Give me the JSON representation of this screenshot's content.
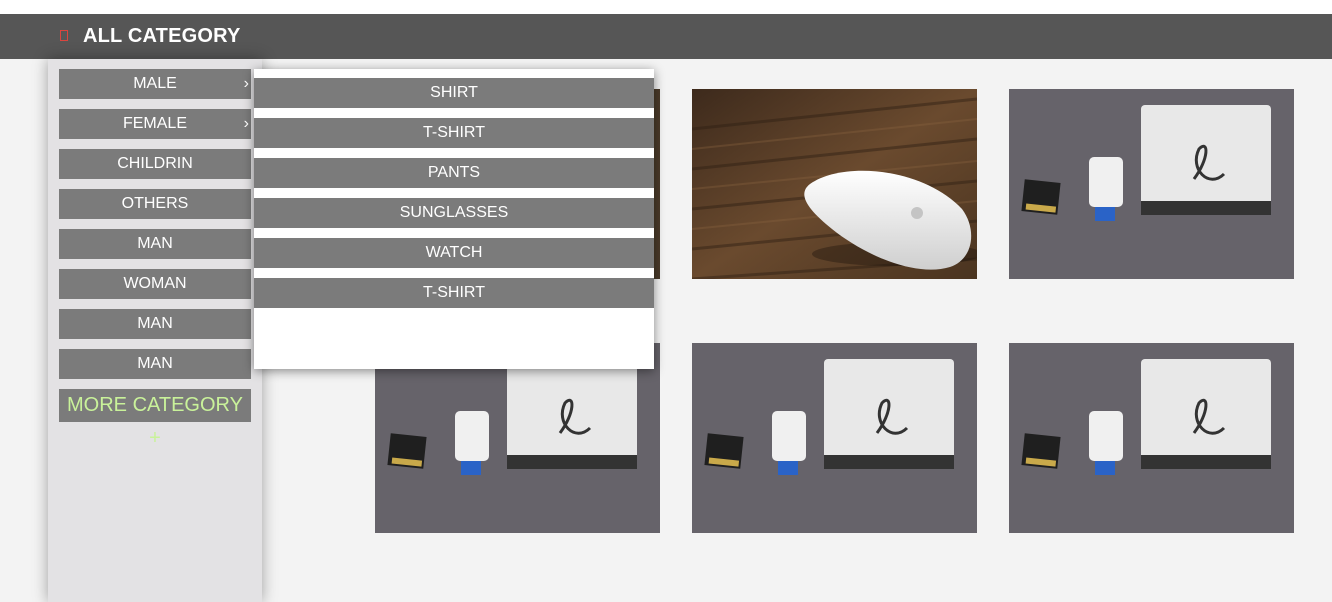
{
  "header": {
    "title": "ALL CATEGORY",
    "menu_icon": "menu-icon",
    "accent": "#d9453e"
  },
  "sidebar": {
    "items": [
      {
        "label": "MALE",
        "has_submenu": true
      },
      {
        "label": "FEMALE",
        "has_submenu": true
      },
      {
        "label": "CHILDRIN",
        "has_submenu": false
      },
      {
        "label": "OTHERS",
        "has_submenu": false
      },
      {
        "label": "MAN",
        "has_submenu": false
      },
      {
        "label": "WOMAN",
        "has_submenu": false
      },
      {
        "label": "MAN",
        "has_submenu": false
      },
      {
        "label": "MAN",
        "has_submenu": false
      }
    ],
    "arrow": "›",
    "more_label": "MORE CATEGORY +",
    "more_color": "#c9f29a"
  },
  "submenu": {
    "items": [
      "SHIRT",
      "T-SHIRT",
      "PANTS",
      "SUNGLASSES",
      "WATCH",
      "T-SHIRT"
    ]
  },
  "products": [
    {
      "image": "hard-drive-usb-sd-photo"
    },
    {
      "image": "magic-mouse-photo"
    },
    {
      "image": "hard-drive-usb-sd-photo"
    },
    {
      "image": "hard-drive-usb-sd-photo"
    },
    {
      "image": "hard-drive-usb-sd-photo"
    },
    {
      "image": "hard-drive-usb-sd-photo"
    }
  ],
  "colors": {
    "bar": "#565656",
    "item": "#7b7b7b",
    "panel": "#e3e2e4",
    "page": "#f3f3f3"
  }
}
